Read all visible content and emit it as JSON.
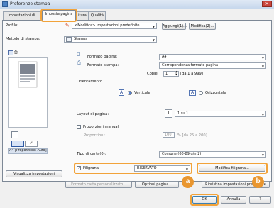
{
  "window": {
    "title": "Preferenze stampa",
    "close_glyph": "✕"
  },
  "tabs": [
    {
      "label": "Impostazioni di base"
    },
    {
      "label": "Imposta pagina"
    },
    {
      "label": "itura"
    },
    {
      "label": "Qualità"
    }
  ],
  "profile": {
    "label": "Profilo:",
    "value": "<Modifica> Impostazioni predefinite",
    "add_label": "Aggiungi(1)...",
    "edit_label": "Modifica(2)..."
  },
  "output_method": {
    "label": "Metodo di stampa:",
    "value": "Stampa"
  },
  "preview": {
    "caption": "A4 [Proporzioni: Auto]",
    "view_settings_label": "Visualizza impostazioni"
  },
  "page": {
    "page_format_label": "Formato pagina:",
    "page_format_value": "A4",
    "output_format_label": "Formato stampa:",
    "output_format_value": "Corrispondenza formato pagina",
    "copies_label": "Copie:",
    "copies_value": "1",
    "copies_range": "[da 1 a 999]",
    "orientation_label": "Orientamento",
    "orientation_vertical": "Verticale",
    "orientation_horizontal": "Orizzontale",
    "orientation_glyph": "A"
  },
  "layout": {
    "label": "Layout di pagina:",
    "value": "1 su 1",
    "icon_glyph": "1"
  },
  "scaling": {
    "manual_label": "Proporzioni manuali",
    "manual_checked": false,
    "ratio_label": "Proporzioni:",
    "ratio_value": "100",
    "ratio_range": "% [da 25 a 200]"
  },
  "paper_type": {
    "label": "Tipo di carta(0):",
    "value": "Comune (60-89 g/m2)"
  },
  "watermark": {
    "label": "Filigrana",
    "checked": true,
    "value": "RISERVATO",
    "edit_label": "Modifica filigrana..."
  },
  "bottom_buttons": {
    "custom_paper_label": "Formato carta personalizzato...",
    "page_options_label": "Opzioni pagina...",
    "restore_label": "Ripristina impostazioni predefinite"
  },
  "dialog_buttons": {
    "ok_label": "OK",
    "cancel_label": "Annulla",
    "help_label": "?"
  },
  "callouts": [
    {
      "letter": "a"
    },
    {
      "letter": "b"
    }
  ],
  "colors": {
    "highlight": "#f2a33a",
    "badge": "#e9962f",
    "selected_radio": "#1f58c9"
  }
}
